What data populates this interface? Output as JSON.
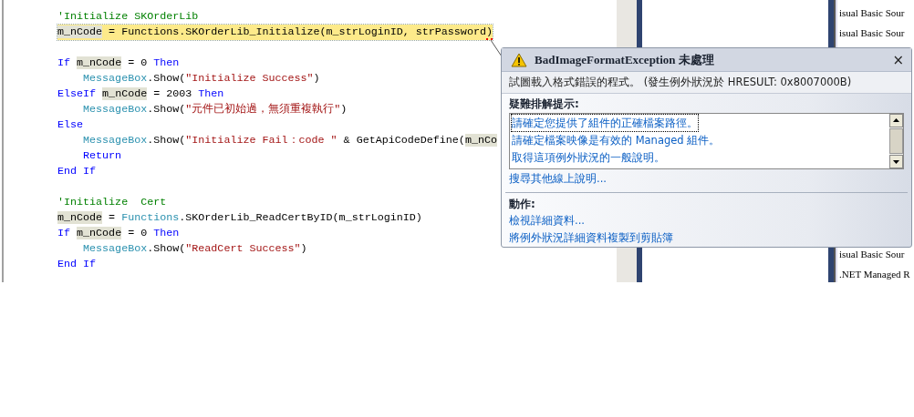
{
  "editor": {
    "lines": [
      {
        "kind": "code",
        "current": false,
        "tokens": [
          {
            "text": "'Initialize SKOrderLib",
            "kind": "comment"
          }
        ]
      },
      {
        "kind": "code",
        "current": true,
        "tokens": [
          {
            "text": "m_nCode",
            "kind": "ref"
          },
          {
            "text": " = Functions.SKOrderLib_Initialize(m_strLoginID, strPassword",
            "kind": "plain"
          },
          {
            "text": ")",
            "kind": "error"
          }
        ]
      },
      {
        "kind": "blank"
      },
      {
        "kind": "code",
        "current": false,
        "tokens": [
          {
            "text": "If ",
            "kind": "keyword"
          },
          {
            "text": "m_nCode",
            "kind": "ref"
          },
          {
            "text": " = 0 ",
            "kind": "plain"
          },
          {
            "text": "Then",
            "kind": "keyword"
          }
        ]
      },
      {
        "kind": "code",
        "current": false,
        "tokens": [
          {
            "text": "    MessageBox",
            "kind": "type"
          },
          {
            "text": ".Show(",
            "kind": "plain"
          },
          {
            "text": "\"Initialize Success\"",
            "kind": "string"
          },
          {
            "text": ")",
            "kind": "plain"
          }
        ]
      },
      {
        "kind": "code",
        "current": false,
        "tokens": [
          {
            "text": "ElseIf ",
            "kind": "keyword"
          },
          {
            "text": "m_nCode",
            "kind": "ref"
          },
          {
            "text": " = 2003 ",
            "kind": "plain"
          },
          {
            "text": "Then",
            "kind": "keyword"
          }
        ]
      },
      {
        "kind": "code",
        "current": false,
        "tokens": [
          {
            "text": "    MessageBox",
            "kind": "type"
          },
          {
            "text": ".Show(",
            "kind": "plain"
          },
          {
            "text": "\"元件已初始過，無須重複執行\"",
            "kind": "string"
          },
          {
            "text": ")",
            "kind": "plain"
          }
        ]
      },
      {
        "kind": "code",
        "current": false,
        "tokens": [
          {
            "text": "Else",
            "kind": "keyword"
          }
        ]
      },
      {
        "kind": "code",
        "current": false,
        "tokens": [
          {
            "text": "    MessageBox",
            "kind": "type"
          },
          {
            "text": ".Show(",
            "kind": "plain"
          },
          {
            "text": "\"Initialize Fail：code \"",
            "kind": "string"
          },
          {
            "text": " & GetApiCodeDefine(",
            "kind": "plain"
          },
          {
            "text": "m_nCo",
            "kind": "ref"
          }
        ]
      },
      {
        "kind": "code",
        "current": false,
        "tokens": [
          {
            "text": "    Return",
            "kind": "keyword"
          }
        ]
      },
      {
        "kind": "code",
        "current": false,
        "tokens": [
          {
            "text": "End If",
            "kind": "keyword"
          }
        ]
      },
      {
        "kind": "blank"
      },
      {
        "kind": "code",
        "current": false,
        "tokens": [
          {
            "text": "'Initialize  Cert",
            "kind": "comment"
          }
        ]
      },
      {
        "kind": "code",
        "current": false,
        "tokens": [
          {
            "text": "m_nCode",
            "kind": "ref"
          },
          {
            "text": " = ",
            "kind": "plain"
          },
          {
            "text": "Functions",
            "kind": "type"
          },
          {
            "text": ".SKOrderLib_ReadCertByID(m_strLoginID)",
            "kind": "plain"
          }
        ]
      },
      {
        "kind": "code",
        "current": false,
        "tokens": [
          {
            "text": "If ",
            "kind": "keyword"
          },
          {
            "text": "m_nCode",
            "kind": "ref"
          },
          {
            "text": " = 0 ",
            "kind": "plain"
          },
          {
            "text": "Then",
            "kind": "keyword"
          }
        ]
      },
      {
        "kind": "code",
        "current": false,
        "tokens": [
          {
            "text": "    MessageBox",
            "kind": "type"
          },
          {
            "text": ".Show(",
            "kind": "plain"
          },
          {
            "text": "\"ReadCert Success\"",
            "kind": "string"
          },
          {
            "text": ")",
            "kind": "plain"
          }
        ]
      },
      {
        "kind": "code",
        "current": false,
        "tokens": [
          {
            "text": "End If",
            "kind": "keyword"
          }
        ]
      }
    ]
  },
  "file_list": {
    "top_items": [
      "isual Basic Sour",
      "isual Basic Sour"
    ],
    "bottom_items": [
      "isual Basic Sour",
      ".NET Managed R"
    ]
  },
  "exception_popup": {
    "title": "BadImageFormatException 未處理",
    "close": "×",
    "message": "試圖載入格式錯誤的程式。 (發生例外狀況於 HRESULT: 0x8007000B)",
    "tips_heading": "疑難排解提示:",
    "tips": [
      {
        "text": "請確定您提供了組件的正確檔案路徑。",
        "selected": true
      },
      {
        "text": "請確定檔案映像是有效的 Managed 組件。",
        "selected": false
      },
      {
        "text": "取得這項例外狀況的一般說明。",
        "selected": false
      }
    ],
    "search_link": "搜尋其他線上說明...",
    "actions_heading": "動作:",
    "actions": [
      "檢視詳細資料...",
      "將例外狀況詳細資料複製到剪貼簿"
    ]
  }
}
